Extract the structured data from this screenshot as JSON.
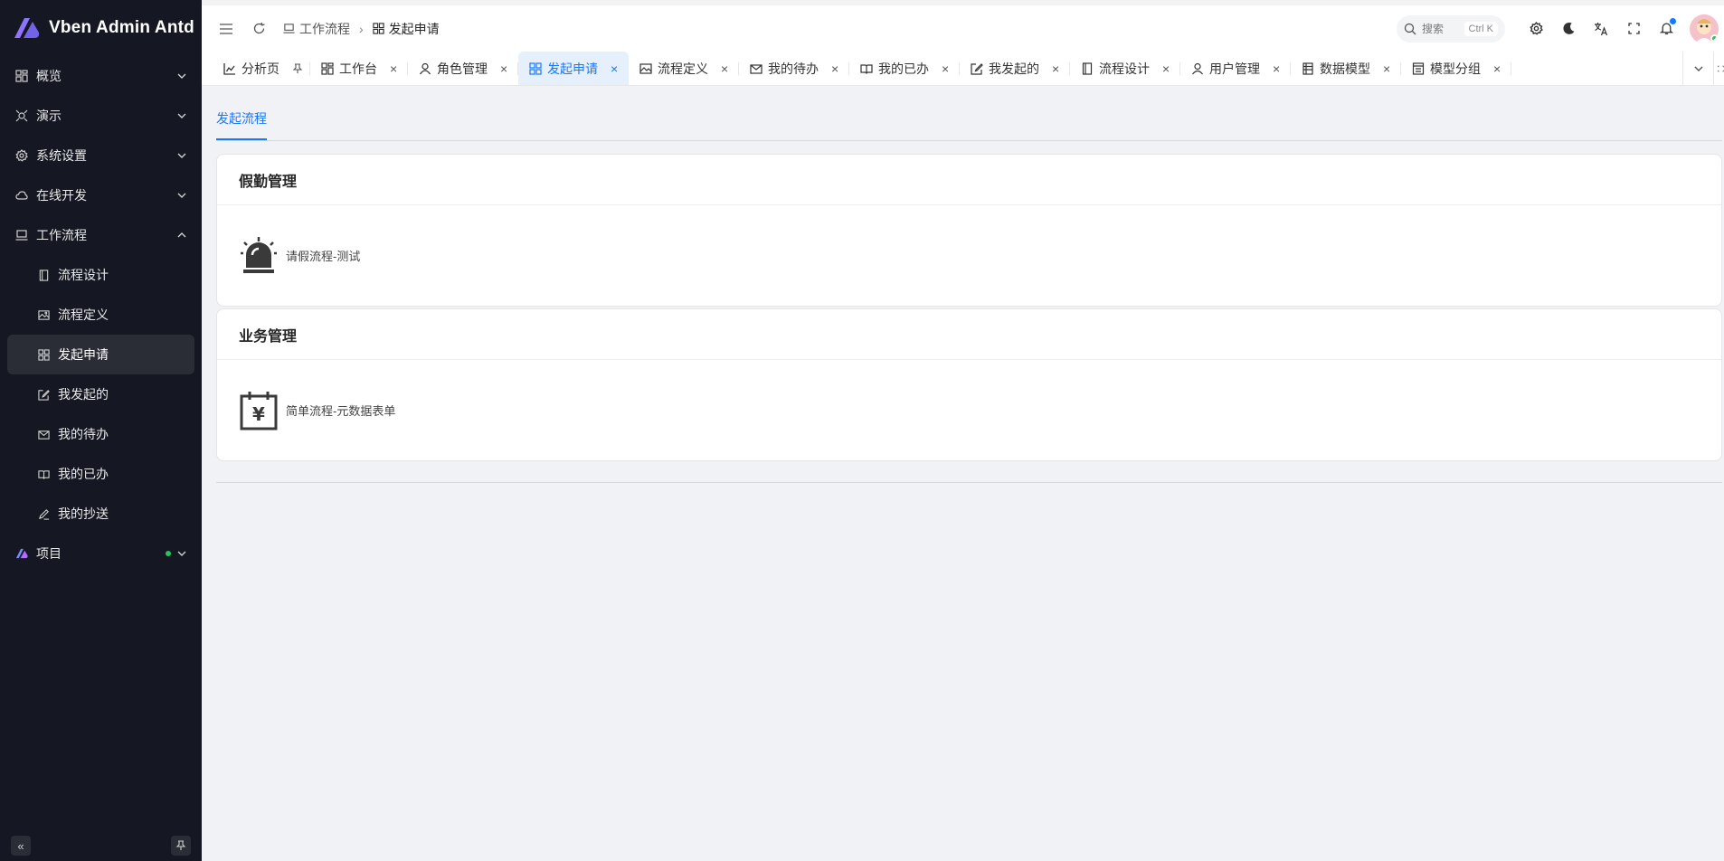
{
  "brand": {
    "name": "Vben Admin Antd"
  },
  "sidebar": {
    "items": [
      {
        "label": "概览",
        "icon": "dashboard-icon"
      },
      {
        "label": "演示",
        "icon": "demo-icon"
      },
      {
        "label": "系统设置",
        "icon": "gear-icon"
      },
      {
        "label": "在线开发",
        "icon": "cloud-icon"
      },
      {
        "label": "工作流程",
        "icon": "laptop-icon",
        "expanded": true
      },
      {
        "label": "项目",
        "icon": "vben-logo-icon"
      }
    ],
    "workflow_children": [
      {
        "label": "流程设计",
        "icon": "document-icon"
      },
      {
        "label": "流程定义",
        "icon": "image-icon"
      },
      {
        "label": "发起申请",
        "icon": "grid-icon",
        "active": true
      },
      {
        "label": "我发起的",
        "icon": "edit-icon"
      },
      {
        "label": "我的待办",
        "icon": "mail-icon"
      },
      {
        "label": "我的已办",
        "icon": "book-icon"
      },
      {
        "label": "我的抄送",
        "icon": "pen-icon"
      }
    ],
    "footer": {
      "collapse_icon": "«",
      "pin_icon": "pin-icon"
    }
  },
  "header": {
    "breadcrumb": [
      {
        "label": "工作流程"
      },
      {
        "label": "发起申请"
      }
    ],
    "search": {
      "placeholder": "搜索",
      "shortcut": "Ctrl K"
    },
    "notification_dot_color": "#1677ff"
  },
  "tabs": [
    {
      "label": "分析页",
      "icon": "chart-icon",
      "pinned": true
    },
    {
      "label": "工作台",
      "icon": "workbench-icon"
    },
    {
      "label": "角色管理",
      "icon": "users-icon"
    },
    {
      "label": "发起申请",
      "icon": "grid-icon",
      "active": true
    },
    {
      "label": "流程定义",
      "icon": "image-icon"
    },
    {
      "label": "我的待办",
      "icon": "mail-icon"
    },
    {
      "label": "我的已办",
      "icon": "book-icon"
    },
    {
      "label": "我发起的",
      "icon": "edit-icon"
    },
    {
      "label": "流程设计",
      "icon": "document-icon"
    },
    {
      "label": "用户管理",
      "icon": "user-icon"
    },
    {
      "label": "数据模型",
      "icon": "table-icon"
    },
    {
      "label": "模型分组",
      "icon": "folder-icon"
    }
  ],
  "content": {
    "sub_tab": "发起流程",
    "categories": [
      {
        "title": "假勤管理",
        "process": {
          "name": "请假流程-测试",
          "icon": "alarm-icon"
        }
      },
      {
        "title": "业务管理",
        "process": {
          "name": "简单流程-元数据表单",
          "icon": "calendar-yen-icon"
        }
      }
    ]
  },
  "colors": {
    "accent": "#1677ff",
    "sidebar_bg": "#151823",
    "page_bg": "#f0f2f5"
  }
}
